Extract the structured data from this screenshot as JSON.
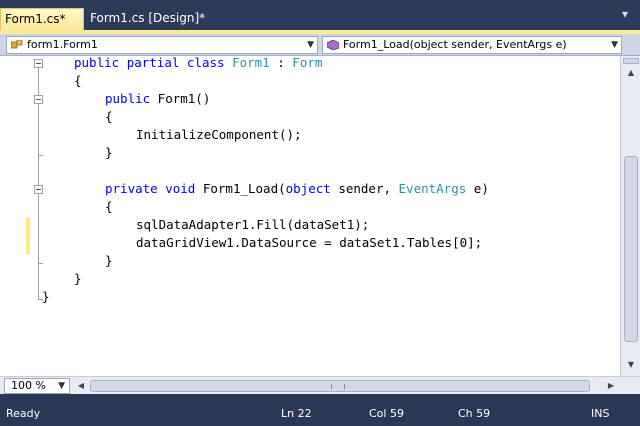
{
  "tabs": [
    {
      "label": "Form1.cs*",
      "active": true
    },
    {
      "label": "Form1.cs [Design]*",
      "active": false
    }
  ],
  "nav": {
    "type_selector": "form1.Form1",
    "member_selector": "Form1_Load(object sender, EventArgs e)"
  },
  "code_lines": [
    "public partial class Form1 : Form",
    "{",
    "public Form1()",
    "{",
    "InitializeComponent();",
    "}",
    "",
    "private void Form1_Load(object sender, EventArgs e)",
    "{",
    "sqlDataAdapter1.Fill(dataSet1);",
    "dataGridView1.DataSource = dataSet1.Tables[0];",
    "}",
    "}",
    "}"
  ],
  "zoom": "100 %",
  "status": {
    "ready": "Ready",
    "line": "Ln 22",
    "col": "Col 59",
    "ch": "Ch 59",
    "mode": "INS"
  },
  "colors": {
    "keyword": "#0000ff",
    "type": "#2b91af",
    "active_tab": "#fde99a",
    "chrome": "#293955",
    "changed_line_marker": "#ffe97a"
  },
  "icons": {
    "type_selector": "class-icon",
    "member_selector": "method-icon"
  }
}
